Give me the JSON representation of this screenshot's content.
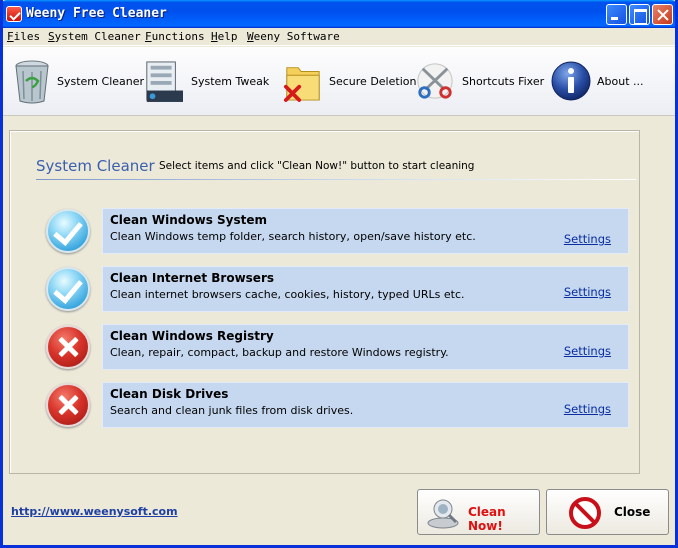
{
  "window": {
    "title": "Weeny Free Cleaner"
  },
  "menu": {
    "items": [
      {
        "first": "F",
        "rest": "iles"
      },
      {
        "first": "S",
        "rest": "ystem Cleaner"
      },
      {
        "first": "F",
        "rest": "unctions"
      },
      {
        "first": "H",
        "rest": "elp"
      },
      {
        "first": "W",
        "rest": "eeny Software"
      }
    ]
  },
  "toolbar": {
    "items": [
      {
        "label": "System Cleaner",
        "icon": "recycle-bin-icon"
      },
      {
        "label": "System Tweak",
        "icon": "system-tweak-icon"
      },
      {
        "label": "Secure Deletion",
        "icon": "secure-deletion-icon"
      },
      {
        "label": "Shortcuts Fixer",
        "icon": "scissors-icon"
      },
      {
        "label": "About ...",
        "icon": "info-icon"
      }
    ]
  },
  "panel": {
    "title": "System Cleaner",
    "subtitle": "Select items and click \"Clean Now!\" button to start cleaning",
    "rows": [
      {
        "title": "Clean Windows System",
        "desc": "Clean Windows temp folder, search history, open/save history etc.",
        "link": "Settings",
        "status": "checked"
      },
      {
        "title": "Clean Internet Browsers",
        "desc": "Clean internet browsers cache, cookies, history, typed URLs etc.",
        "link": "Settings",
        "status": "checked"
      },
      {
        "title": "Clean Windows Registry",
        "desc": "Clean, repair, compact, backup and restore Windows registry.",
        "link": "Settings",
        "status": "unchecked"
      },
      {
        "title": "Clean Disk Drives",
        "desc": "Search and clean junk files from disk drives.",
        "link": "Settings",
        "status": "unchecked"
      }
    ]
  },
  "footer": {
    "url": "http://www.weenysoft.com",
    "clean_label": "Clean Now!",
    "close_label": "Close"
  },
  "colors": {
    "accent": "#3a5fae",
    "row_bg": "#c6d8f0",
    "clean_text": "#e01010"
  }
}
